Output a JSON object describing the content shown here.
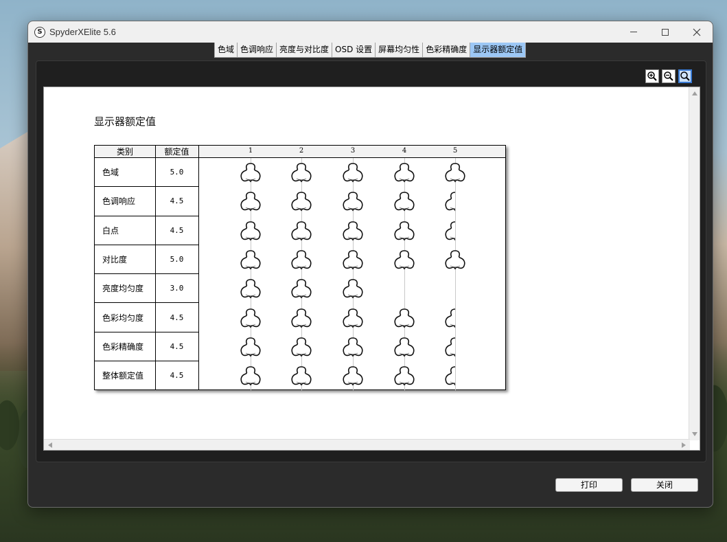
{
  "window": {
    "title": "SpyderXElite 5.6",
    "icon_letter": "S"
  },
  "tabs": [
    {
      "label": "色域",
      "active": false
    },
    {
      "label": "色调响应",
      "active": false
    },
    {
      "label": "亮度与对比度",
      "active": false
    },
    {
      "label": "OSD 设置",
      "active": false
    },
    {
      "label": "屏幕均匀性",
      "active": false
    },
    {
      "label": "色彩精确度",
      "active": false
    },
    {
      "label": "显示器额定值",
      "active": true
    }
  ],
  "report": {
    "title": "显示器额定值",
    "headers": {
      "category": "类别",
      "rating": "额定值",
      "scale": [
        "1",
        "2",
        "3",
        "4",
        "5"
      ]
    },
    "rows": [
      {
        "label": "色域",
        "value": "5.0",
        "rating": 5.0
      },
      {
        "label": "色调响应",
        "value": "4.5",
        "rating": 4.5
      },
      {
        "label": "白点",
        "value": "4.5",
        "rating": 4.5
      },
      {
        "label": "对比度",
        "value": "5.0",
        "rating": 5.0
      },
      {
        "label": "亮度均匀度",
        "value": "3.0",
        "rating": 3.0
      },
      {
        "label": "色彩均匀度",
        "value": "4.5",
        "rating": 4.5
      },
      {
        "label": "色彩精确度",
        "value": "4.5",
        "rating": 4.5
      },
      {
        "label": "整体额定值",
        "value": "4.5",
        "rating": 4.5
      }
    ]
  },
  "buttons": {
    "print": "打印",
    "close": "关闭"
  },
  "icons": {
    "zoom_in": "zoom-in-icon",
    "zoom_out": "zoom-out-icon",
    "zoom_fit": "zoom-fit-icon",
    "rating_mark": "spyder-icon"
  }
}
